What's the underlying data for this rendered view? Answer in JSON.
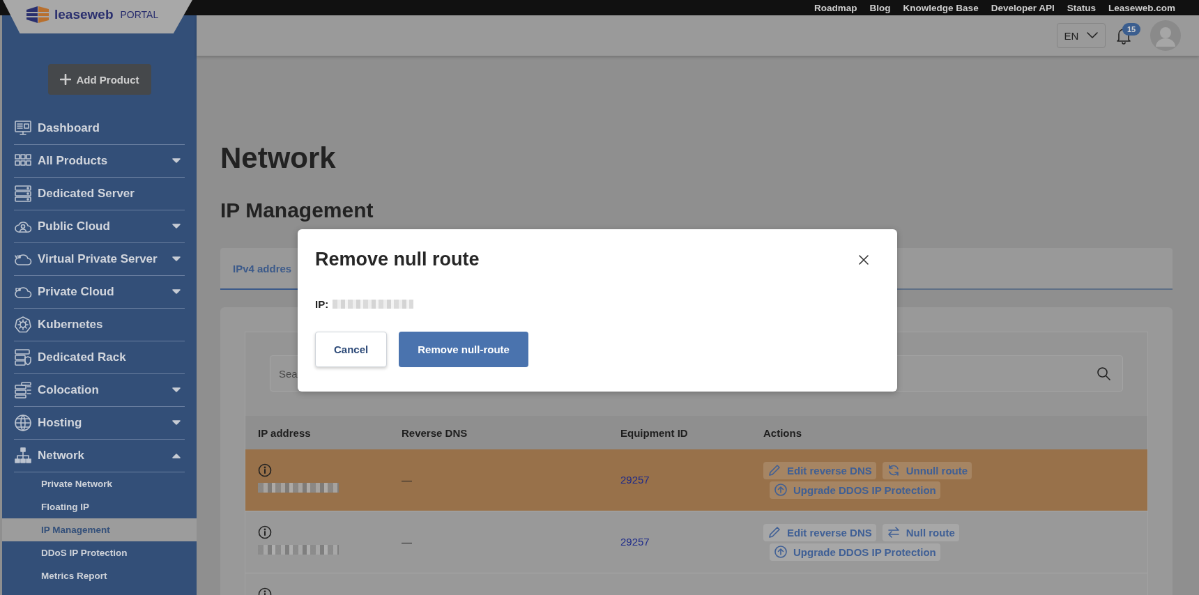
{
  "top_links": [
    "Roadmap",
    "Blog",
    "Knowledge Base",
    "Developer API",
    "Status",
    "Leaseweb.com"
  ],
  "logo": {
    "name": "leaseweb",
    "suffix": "PORTAL"
  },
  "header": {
    "language": "EN",
    "notifications": "15"
  },
  "sidebar": {
    "add_button": "Add Product",
    "items": [
      {
        "label": "Dashboard",
        "kind": "link"
      },
      {
        "label": "All Products",
        "kind": "menu",
        "expanded": false
      },
      {
        "label": "Dedicated Server",
        "kind": "link"
      },
      {
        "label": "Public Cloud",
        "kind": "menu",
        "expanded": false
      },
      {
        "label": "Virtual Private Server",
        "kind": "menu",
        "expanded": false
      },
      {
        "label": "Private Cloud",
        "kind": "menu",
        "expanded": false
      },
      {
        "label": "Kubernetes",
        "kind": "link"
      },
      {
        "label": "Dedicated Rack",
        "kind": "link"
      },
      {
        "label": "Colocation",
        "kind": "menu",
        "expanded": false
      },
      {
        "label": "Hosting",
        "kind": "menu",
        "expanded": false
      },
      {
        "label": "Network",
        "kind": "menu",
        "expanded": true,
        "children": [
          {
            "label": "Private Network",
            "selected": false
          },
          {
            "label": "Floating IP",
            "selected": false
          },
          {
            "label": "IP Management",
            "selected": true
          },
          {
            "label": "DDoS IP Protection",
            "selected": false
          },
          {
            "label": "Metrics Report",
            "selected": false
          }
        ]
      }
    ]
  },
  "page": {
    "title": "Network",
    "subtitle": "IP Management"
  },
  "tabs": [
    {
      "label": "IPv4 addres",
      "selected": true
    }
  ],
  "search": {
    "placeholder": "Sea"
  },
  "table": {
    "columns": [
      "IP address",
      "Reverse DNS",
      "Equipment ID",
      "Actions"
    ],
    "rows": [
      {
        "highlighted": true,
        "reverse_dns": "—",
        "equipment_id": "29257",
        "actions": [
          {
            "kind": "edit",
            "label": "Edit reverse DNS"
          },
          {
            "kind": "unnull",
            "label": "Unnull route"
          },
          {
            "kind": "upgrade",
            "label": "Upgrade DDOS IP Protection"
          }
        ]
      },
      {
        "highlighted": false,
        "reverse_dns": "—",
        "equipment_id": "29257",
        "actions": [
          {
            "kind": "edit",
            "label": "Edit reverse DNS"
          },
          {
            "kind": "null",
            "label": "Null route"
          },
          {
            "kind": "upgrade",
            "label": "Upgrade DDOS IP Protection"
          }
        ]
      },
      {
        "highlighted": false
      }
    ]
  },
  "modal": {
    "title": "Remove null route",
    "ip_label": "IP:",
    "buttons": [
      {
        "kind": "secondary",
        "label": "Cancel"
      },
      {
        "kind": "primary",
        "label": "Remove null-route"
      }
    ]
  }
}
